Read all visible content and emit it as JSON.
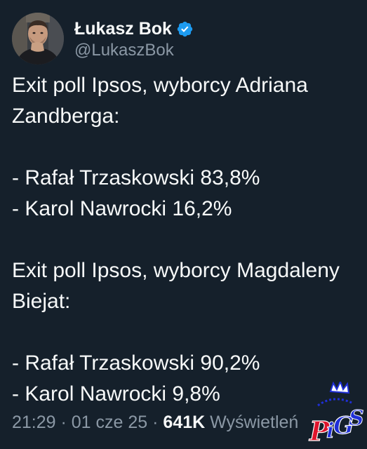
{
  "author": {
    "display_name": "Łukasz Bok",
    "handle": "@LukaszBok",
    "verified": true,
    "avatar_icon": "avatar-photo",
    "verified_icon": "verified-badge-icon"
  },
  "tweet": {
    "text": "Exit poll Ipsos, wyborcy Adriana Zandberga:\n\n- Rafał Trzaskowski 83,8%\n- Karol Nawrocki 16,2%\n\nExit poll Ipsos, wyborcy Magdaleny Biejat:\n\n- Rafał Trzaskowski 90,2%\n- Karol Nawrocki 9,8%"
  },
  "meta": {
    "time": "21:29",
    "date": "01 cze 25",
    "separator": " · ",
    "views_count": "641K",
    "views_label": "Wyświetleń"
  },
  "watermark": {
    "text": "PiGS"
  },
  "colors": {
    "background": "#15202b",
    "text_primary": "#f7f9f9",
    "text_secondary": "#8b98a5",
    "verified_blue": "#1d9bf0",
    "watermark_blue": "#1f2fd6",
    "watermark_red": "#e0142c"
  }
}
